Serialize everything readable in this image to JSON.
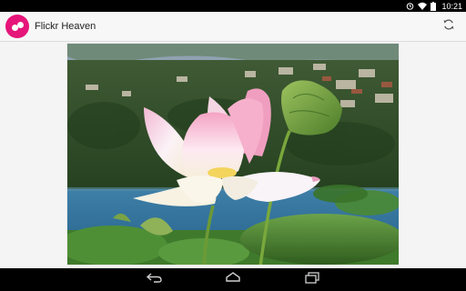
{
  "status_bar": {
    "time": "10:21",
    "icons": [
      "alarm-icon",
      "wifi-icon",
      "battery-icon"
    ]
  },
  "action_bar": {
    "app_title": "Flickr Heaven",
    "logo_icon": "flickr-logo-icon",
    "refresh_icon": "refresh-icon"
  },
  "content": {
    "photo_subject": "pink-white lotus flower photo"
  },
  "nav_bar": {
    "buttons": [
      "back-icon",
      "home-icon",
      "recents-icon"
    ]
  },
  "colors": {
    "accent": "#e5157a",
    "status_bar": "#000000",
    "action_bar": "#f7f7f7",
    "nav_bar": "#000000"
  }
}
